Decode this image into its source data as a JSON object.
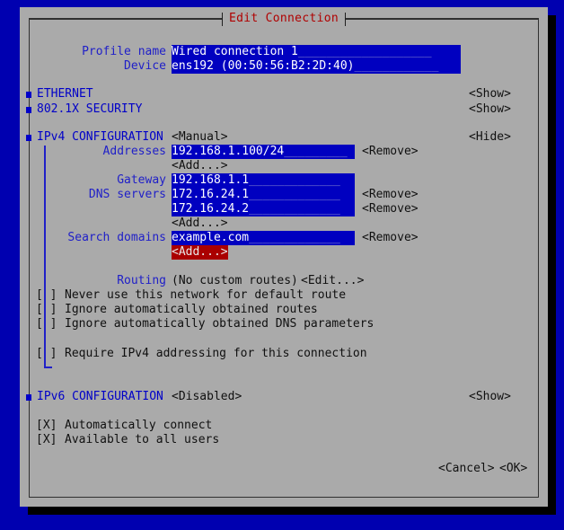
{
  "window": {
    "title": "Edit Connection",
    "title_color": "#b00000",
    "background_color": "#aaaaaa",
    "desktop_color": "#0000b0"
  },
  "form": {
    "profile_name": {
      "label": "Profile name",
      "value": "Wired connection 1",
      "pad": "___________________"
    },
    "device": {
      "label": "Device",
      "value": "ens192 (00:50:56:B2:2D:40)",
      "pad": "____________"
    }
  },
  "sections": [
    {
      "label": "ETHERNET",
      "toggle": "<Show>"
    },
    {
      "label": "802.1X SECURITY",
      "toggle": "<Show>"
    }
  ],
  "ipv4": {
    "label": "IPv4 CONFIGURATION",
    "mode": "<Manual>",
    "toggle": "<Hide>",
    "addresses": {
      "label": "Addresses",
      "entries": [
        {
          "value": "192.168.1.100/24",
          "pad": "_________",
          "action": "<Remove>"
        }
      ],
      "add": "<Add...>"
    },
    "gateway": {
      "label": "Gateway",
      "value": "192.168.1.1",
      "pad": "_____________"
    },
    "dns_servers": {
      "label": "DNS servers",
      "entries": [
        {
          "value": "172.16.24.1",
          "pad": "_____________",
          "action": "<Remove>"
        },
        {
          "value": "172.16.24.2",
          "pad": "_____________",
          "action": "<Remove>"
        }
      ],
      "add": "<Add...>"
    },
    "search_domains": {
      "label": "Search domains",
      "entries": [
        {
          "value": "example.com",
          "pad": "_____________",
          "action": "<Remove>"
        }
      ],
      "add": "<Add...>",
      "add_selected": true
    },
    "routing": {
      "label": "Routing",
      "status": "(No custom routes)",
      "edit": "<Edit...>"
    },
    "checkboxes": [
      {
        "mark": "[ ]",
        "label": "Never use this network for default route"
      },
      {
        "mark": "[ ]",
        "label": "Ignore automatically obtained routes"
      },
      {
        "mark": "[ ]",
        "label": "Ignore automatically obtained DNS parameters"
      },
      {
        "mark": "[ ]",
        "label": "Require IPv4 addressing for this connection"
      }
    ]
  },
  "ipv6": {
    "label": "IPv6 CONFIGURATION",
    "mode": "<Disabled>",
    "toggle": "<Show>"
  },
  "global_options": [
    {
      "mark": "[X]",
      "label": "Automatically connect"
    },
    {
      "mark": "[X]",
      "label": "Available to all users"
    }
  ],
  "buttons": {
    "cancel": "<Cancel>",
    "ok": "<OK>"
  }
}
